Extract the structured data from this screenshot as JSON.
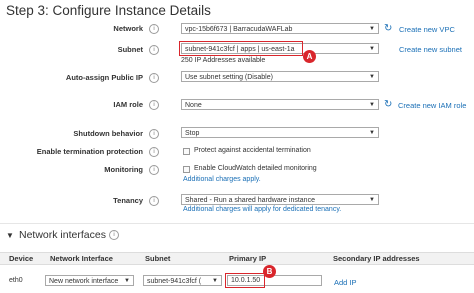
{
  "page": {
    "title": "Step 3: Configure Instance Details"
  },
  "network": {
    "label": "Network",
    "value": "vpc-15b6f673 | BarracudaWAFLab",
    "link": "Create new VPC"
  },
  "subnet": {
    "label": "Subnet",
    "value": "subnet-941c3fcf | apps | us-east-1a",
    "link": "Create new subnet",
    "available": "250 IP Addresses available",
    "badge": "A"
  },
  "auto_assign": {
    "label": "Auto-assign Public IP",
    "value": "Use subnet setting (Disable)"
  },
  "iam_role": {
    "label": "IAM role",
    "value": "None",
    "link": "Create new IAM role"
  },
  "shutdown": {
    "label": "Shutdown behavior",
    "value": "Stop"
  },
  "termination": {
    "label": "Enable termination protection",
    "option": "Protect against accidental termination",
    "checked": false
  },
  "monitoring": {
    "label": "Monitoring",
    "option": "Enable CloudWatch detailed monitoring",
    "note": "Additional charges apply.",
    "checked": false
  },
  "tenancy": {
    "label": "Tenancy",
    "value": "Shared - Run a shared hardware instance",
    "note": "Additional charges will apply for dedicated tenancy."
  },
  "network_interfaces": {
    "title": "Network interfaces",
    "headers": [
      "Device",
      "Network Interface",
      "Subnet",
      "Primary IP",
      "Secondary IP addresses"
    ],
    "row": {
      "device": "eth0",
      "interface": "New network interface",
      "subnet": "subnet-941c3fcf (",
      "primary_ip": "10.0.1.50",
      "add_ip": "Add IP"
    },
    "badge": "B"
  },
  "colors": {
    "link": "#1a6fb6",
    "highlight": "#d9262c",
    "text": "#333333"
  },
  "icons": [
    "info-icon",
    "refresh-icon",
    "caret-down-icon",
    "collapse-triangle-icon"
  ]
}
